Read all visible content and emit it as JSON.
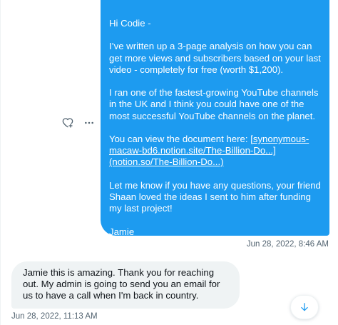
{
  "sent_message": {
    "greeting": "Hi Codie -",
    "paragraph_1": "I’ve written up a 3-page analysis on how you can get more views and subscribers based on your last video - completely for free (worth $1,200).",
    "paragraph_2": "I ran one of the fastest-growing YouTube channels in the UK and I think you could have one of the most successful YouTube channels on the planet.",
    "paragraph_3_prefix": "You can view the document here: ",
    "link_1": "[synonymous-macaw-bd6.notion.site/The-Billion-Do...]",
    "link_2": "(notion.so/The-Billion-Do...)",
    "paragraph_4": "Let me know if you have any questions, your friend Shaan loved the ideas I sent to him after funding my last project!",
    "signature": "Jamie",
    "timestamp": "Jun 28, 2022, 8:46 AM"
  },
  "received_message": {
    "text": "Jamie this is amazing. Thank you for reaching out. My admin is going to send you an email for us to have a call when I'm back in country.",
    "timestamp": "Jun 28, 2022, 11:13 AM"
  },
  "icons": {
    "react": "heart-plus-icon",
    "more": "more-horizontal-icon",
    "scroll": "arrow-down-icon"
  },
  "colors": {
    "sent_bubble": "#1d9bf0",
    "received_bubble": "#eff3f4",
    "secondary_text": "#536471",
    "accent": "#1d9bf0"
  }
}
